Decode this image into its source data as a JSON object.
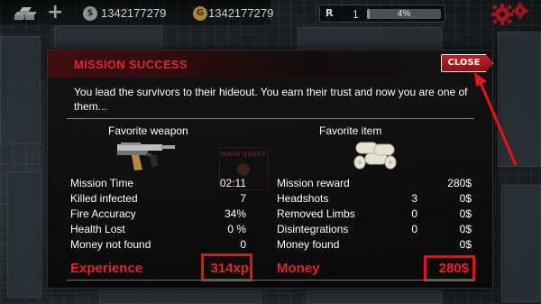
{
  "hud": {
    "silver_amount": "1342177279",
    "gold_amount": "1342177279",
    "silver_coin_symbol": "$",
    "gold_coin_symbol": "G",
    "rank_label": "R",
    "rank_level": "1",
    "xp_percent_text": "4%",
    "xp_progress": 0.04
  },
  "dialog": {
    "title": "MISSION SUCCESS",
    "close_label": "CLOSE",
    "message": "You lead the survivors to their hideout. You earn their trust and now you are one of them...",
    "favorite_weapon_label": "Favorite weapon",
    "favorite_item_label": "Favorite item",
    "watermark_text": "MAIN QUEST",
    "left_stats": [
      {
        "label": "Mission Time",
        "value": "02:11"
      },
      {
        "label": "Killed infected",
        "value": "7"
      },
      {
        "label": "Fire Accuracy",
        "value": "34%"
      },
      {
        "label": "Health Lost",
        "value": "0 %"
      },
      {
        "label": "Money not found",
        "value": "0"
      }
    ],
    "right_stats": [
      {
        "label": "Mission reward",
        "count": "",
        "value": "280$"
      },
      {
        "label": "Headshots",
        "count": "3",
        "value": "0$"
      },
      {
        "label": "Removed Limbs",
        "count": "0",
        "value": "0$"
      },
      {
        "label": "Disintegrations",
        "count": "0",
        "value": "0$"
      },
      {
        "label": "Money found",
        "count": "",
        "value": "0$"
      }
    ],
    "experience_label": "Experience",
    "experience_value": "314xp",
    "money_label": "Money",
    "money_value": "280$"
  },
  "colors": {
    "accent_red": "#e3242b",
    "highlight_red": "#e8101a",
    "close_button": "#c01f25"
  },
  "icons": [
    "gold-bars-icon",
    "plus-icon",
    "silver-coin-icon",
    "gold-coin-icon",
    "gear-icon",
    "weapon-smg-icon",
    "bandage-rolls-icon"
  ]
}
